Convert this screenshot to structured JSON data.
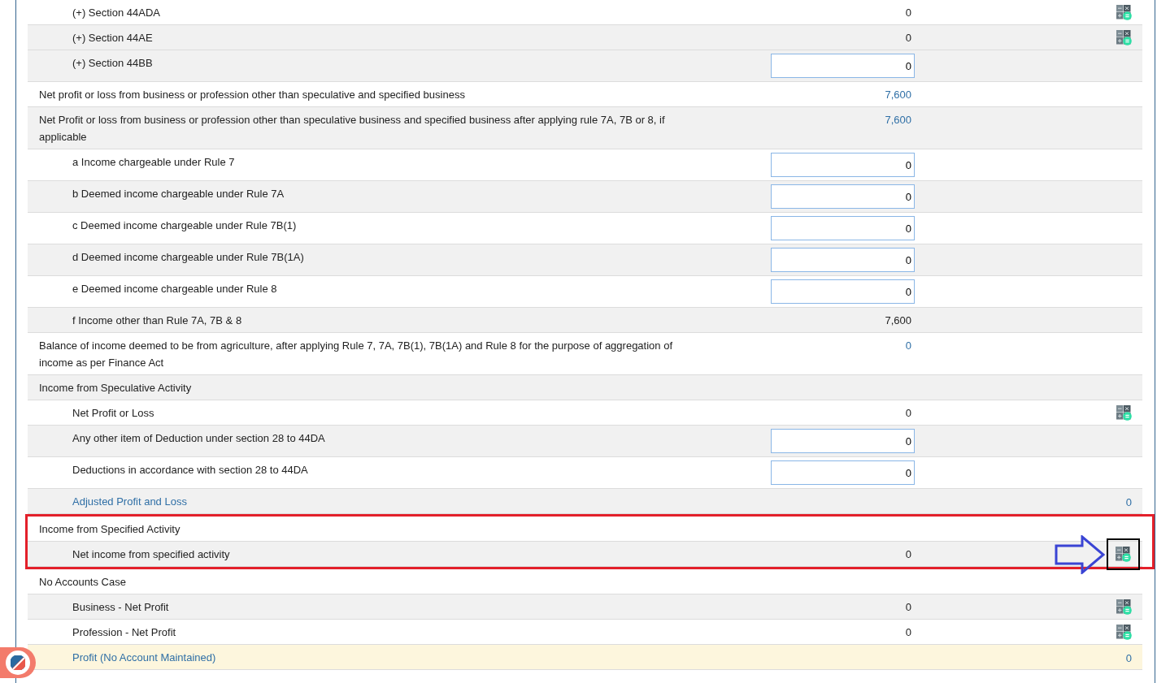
{
  "rows": [
    {
      "children": [
        {
          "label": "(+) Section 44ADA",
          "kind": "text",
          "value": "0",
          "calculator": true
        },
        {
          "label": "(+) Section 44AE",
          "shaded": true,
          "kind": "text",
          "value": "0",
          "calculator": true
        },
        {
          "label": "(+) Section 44BB",
          "shaded": true,
          "kind": "input",
          "value": "0"
        }
      ]
    },
    {
      "label": "Net profit or loss from business or profession other than speculative and specified business",
      "kind": "link",
      "value": "7,600"
    },
    {
      "label": "Net Profit or loss from business or profession other than speculative business and specified business after applying rule 7A, 7B or 8, if applicable",
      "shaded": true,
      "kind": "link",
      "value": "7,600",
      "children": [
        {
          "label": "a Income chargeable under Rule 7",
          "kind": "input",
          "value": "0"
        },
        {
          "label": "b Deemed income chargeable under Rule 7A",
          "shaded": true,
          "kind": "input",
          "value": "0"
        },
        {
          "label": "c Deemed income chargeable under Rule 7B(1)",
          "kind": "input",
          "value": "0"
        },
        {
          "label": "d Deemed income chargeable under Rule 7B(1A)",
          "shaded": true,
          "kind": "input",
          "value": "0"
        },
        {
          "label": "e Deemed income chargeable under Rule 8",
          "kind": "input",
          "value": "0"
        },
        {
          "label": "f Income other than Rule 7A, 7B & 8",
          "shaded": true,
          "kind": "text",
          "value": "7,600"
        }
      ]
    },
    {
      "label": "Balance of income deemed to be from agriculture, after applying Rule 7, 7A, 7B(1), 7B(1A) and Rule 8 for the purpose of aggregation of income as per Finance Act",
      "kind": "link",
      "value": "0"
    },
    {
      "label": "Income from Speculative Activity",
      "shaded": true,
      "children": [
        {
          "label": "Net Profit or Loss",
          "kind": "text",
          "value": "0",
          "calculator": true
        },
        {
          "label": "Any other item of Deduction under section 28 to 44DA",
          "shaded": true,
          "kind": "input",
          "value": "0"
        },
        {
          "label": "Deductions in accordance with section 28 to 44DA",
          "kind": "input",
          "value": "0"
        },
        {
          "label": "Adjusted Profit and Loss",
          "shaded": true,
          "kind": "total",
          "value": "0"
        }
      ]
    },
    {
      "label": "Income from Specified Activity",
      "highlighted": true,
      "children": [
        {
          "label": "Net income from specified activity",
          "shaded": true,
          "kind": "text",
          "value": "0",
          "calculator": true,
          "highlighted": true,
          "pointed": true
        }
      ]
    },
    {
      "label": "No Accounts Case",
      "children": [
        {
          "label": "Business - Net Profit",
          "shaded": true,
          "kind": "text",
          "value": "0",
          "calculator": true
        },
        {
          "label": "Profession - Net Profit",
          "kind": "text",
          "value": "0",
          "calculator": true
        },
        {
          "label": "Profit (No Account Maintained)",
          "emphasized": true,
          "kind": "total",
          "value": "0"
        }
      ]
    }
  ]
}
